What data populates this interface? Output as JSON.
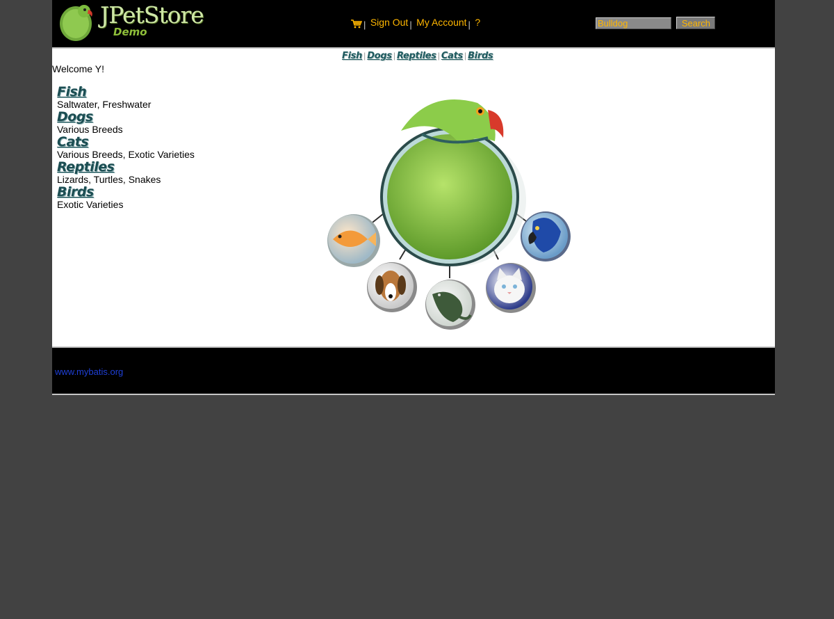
{
  "header": {
    "logo_title": "JPetStore",
    "logo_subtitle": "Demo",
    "menu": {
      "sign_out": "Sign Out",
      "my_account": "My Account",
      "help": "?"
    },
    "search": {
      "value": "Bulldog",
      "button_label": "Search"
    }
  },
  "quicklinks": [
    "Fish",
    "Dogs",
    "Reptiles",
    "Cats",
    "Birds"
  ],
  "welcome": "Welcome Y!",
  "sidebar": {
    "categories": [
      {
        "name": "Fish",
        "description": "Saltwater, Freshwater"
      },
      {
        "name": "Dogs",
        "description": "Various Breeds"
      },
      {
        "name": "Cats",
        "description": "Various Breeds, Exotic Varieties"
      },
      {
        "name": "Reptiles",
        "description": "Lizards, Turtles, Snakes"
      },
      {
        "name": "Birds",
        "description": "Exotic Varieties"
      }
    ]
  },
  "footer": {
    "link": "www.mybatis.org"
  },
  "colors": {
    "page_bg": "#424242",
    "header_bg": "#000000",
    "menu_link": "#ffb600",
    "category_title": "#1b4d52",
    "footer_link": "#1e3fd6"
  }
}
